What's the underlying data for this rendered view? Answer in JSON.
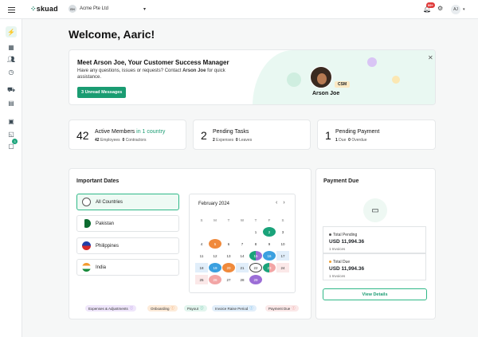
{
  "topbar": {
    "brand": "skuad",
    "company_initials": "EH",
    "company_name": "Acme Pte Ltd",
    "notification_count": "99+",
    "user_initials": "AJ"
  },
  "sidebar": {
    "chat_badge": "3"
  },
  "welcome": "Welcome, Aaric!",
  "csm": {
    "title": "Meet Arson Joe, Your Customer Success Manager",
    "text_prefix": "Have any questions, issues or requests? Contact ",
    "text_name": "Arson Joe",
    "text_suffix": " for quick assistance.",
    "button": "3 Unread Messages",
    "tag": "CSM",
    "name": "Arson Joe"
  },
  "stats": [
    {
      "num": "42",
      "title": "Active Members",
      "title_extra": "in 1 country",
      "sub1_n": "42",
      "sub1_l": "Employees",
      "sub2_n": "0",
      "sub2_l": "Contractors"
    },
    {
      "num": "2",
      "title": "Pending Tasks",
      "sub1_n": "2",
      "sub1_l": "Expenses",
      "sub2_n": "0",
      "sub2_l": "Leaves"
    },
    {
      "num": "1",
      "title": "Pending Payment",
      "sub1_n": "1",
      "sub1_l": "Due",
      "sub2_n": "0",
      "sub2_l": "Overdue"
    }
  ],
  "important_dates": {
    "title": "Important Dates",
    "countries": [
      "All Countries",
      "Pakistan",
      "Philippines",
      "India"
    ],
    "calendar": {
      "month": "February 2024",
      "weekdays": [
        "S",
        "M",
        "T",
        "W",
        "T",
        "F",
        "S"
      ],
      "days": [
        "",
        "",
        "",
        "",
        "1",
        "2",
        "3",
        "4",
        "5",
        "6",
        "7",
        "8",
        "9",
        "10",
        "11",
        "12",
        "13",
        "14",
        "15",
        "16",
        "17",
        "18",
        "19",
        "20",
        "21",
        "22",
        "23",
        "24",
        "25",
        "26",
        "27",
        "28",
        "29",
        "",
        ""
      ]
    },
    "legend": [
      "Expenses & Adjustments",
      "Onboarding",
      "Payout",
      "Invoice Raise Period",
      "Payment Due"
    ]
  },
  "payment_due": {
    "title": "Payment Due",
    "total_pending_label": "Total Pending",
    "total_pending_amount": "USD 11,994.36",
    "total_pending_sub": "1 Invoices",
    "total_due_label": "Total Due",
    "total_due_amount": "USD 11,994.36",
    "total_due_sub": "1 Invoices",
    "button": "View Details"
  },
  "colors": {
    "accent": "#1a9c72",
    "expenses": "#9b6dd6",
    "onboarding": "#f08a3c",
    "payout": "#1aa37a",
    "invoice": "#3aa0e0",
    "payment_due": "#f2a5a5"
  }
}
